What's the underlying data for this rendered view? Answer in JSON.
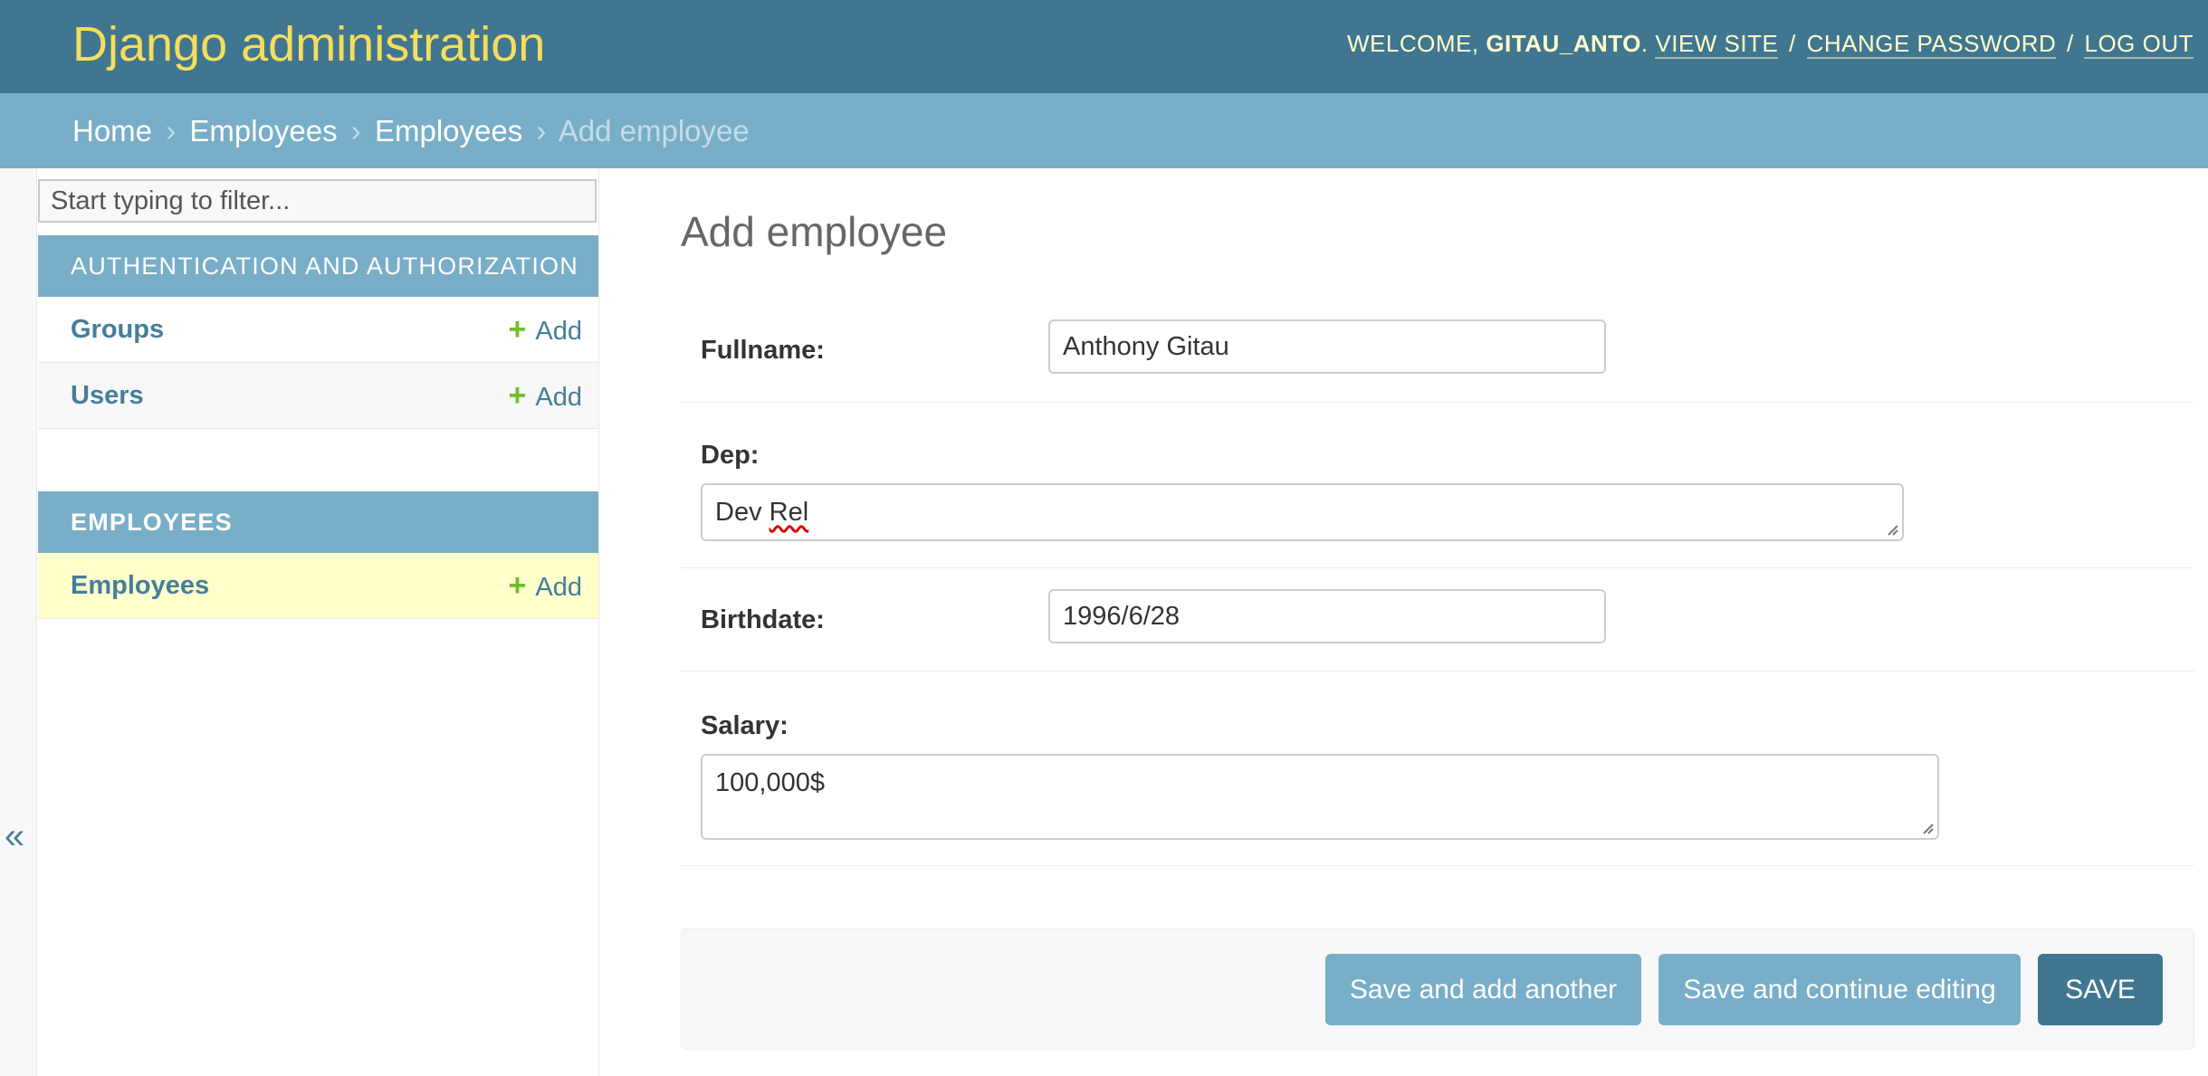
{
  "header": {
    "site_title": "Django administration",
    "welcome_prefix": "WELCOME,",
    "username": "GITAU_ANTO",
    "view_site": "VIEW SITE",
    "change_password": "CHANGE PASSWORD",
    "log_out": "LOG OUT",
    "separator": "/"
  },
  "breadcrumbs": {
    "items": [
      "Home",
      "Employees",
      "Employees",
      "Add employee"
    ],
    "separator": "›"
  },
  "sidebar": {
    "toggle_glyph": "«",
    "filter_placeholder": "Start typing to filter...",
    "modules": [
      {
        "caption": "AUTHENTICATION AND AUTHORIZATION",
        "models": [
          {
            "name": "Groups",
            "add_label": "Add"
          },
          {
            "name": "Users",
            "add_label": "Add"
          }
        ]
      },
      {
        "caption": "EMPLOYEES",
        "models": [
          {
            "name": "Employees",
            "add_label": "Add",
            "current": true
          }
        ]
      }
    ],
    "plus_glyph": "+"
  },
  "form": {
    "title": "Add employee",
    "fields": {
      "fullname": {
        "label": "Fullname:",
        "value": "Anthony Gitau"
      },
      "dep": {
        "label": "Dep:",
        "value_word1": "Dev",
        "value_word2": "Rel"
      },
      "birthdate": {
        "label": "Birthdate:",
        "value": "1996/6/28"
      },
      "salary": {
        "label": "Salary:",
        "value": "100,000$"
      }
    }
  },
  "submit": {
    "save_add_another": "Save and add another",
    "save_continue": "Save and continue editing",
    "save": "SAVE"
  },
  "colors": {
    "header_bg": "#417690",
    "breadcrumb_bg": "#79aec8",
    "brand_yellow": "#f5dd5d",
    "link_blue": "#447e9b",
    "add_green": "#70bf2b",
    "current_row": "#ffffcc"
  }
}
